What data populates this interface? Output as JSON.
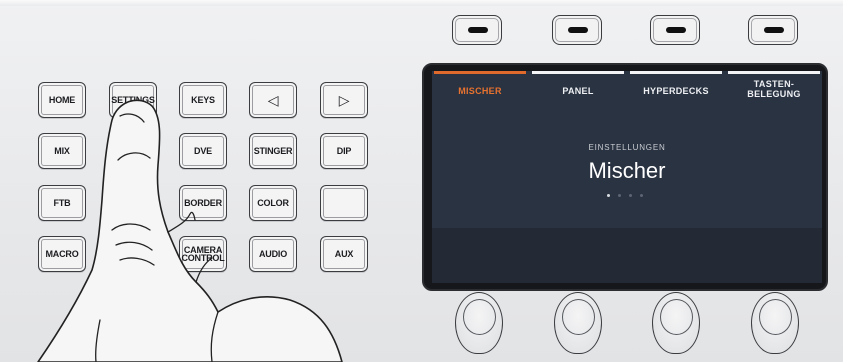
{
  "keypad": {
    "row1": [
      "HOME",
      "SETTINGS",
      "KEYS",
      "◁",
      "▷"
    ],
    "row2": [
      "MIX",
      "",
      "DVE",
      "STINGER",
      "DIP"
    ],
    "row3": [
      "FTB",
      "",
      "BORDER",
      "COLOR",
      ""
    ],
    "row4": [
      "MACRO",
      "",
      "CAMERA CONTROL",
      "AUDIO",
      "AUX"
    ]
  },
  "lcd": {
    "tabs": [
      {
        "label": "MISCHER",
        "active": true
      },
      {
        "label": "PANEL",
        "active": false
      },
      {
        "label": "HYPERDECKS",
        "active": false
      },
      {
        "label": "TASTEN-",
        "label2": "BELEGUNG",
        "active": false
      }
    ],
    "subtitle": "EINSTELLUNGEN",
    "title": "Mischer",
    "page_indicator": {
      "pages": 4,
      "current": 1
    }
  },
  "colors": {
    "accent": "#e8722f",
    "lcd_bg": "#2a3342"
  }
}
